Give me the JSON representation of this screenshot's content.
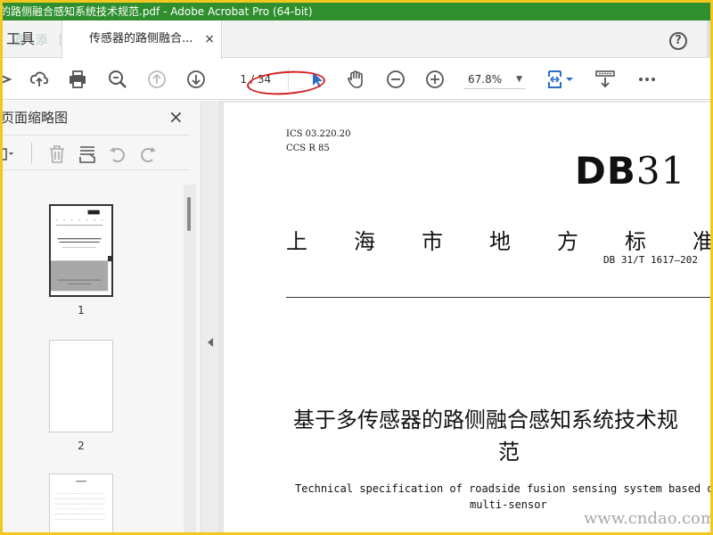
{
  "window": {
    "title": "的路侧融合感知系统技术规范.pdf - Adobe Acrobat Pro (64-bit)"
  },
  "tabs": {
    "tools_label": "工具",
    "doc_label": "传感器的路侧融合...",
    "close_glyph": "×"
  },
  "help": {
    "glyph": "?"
  },
  "watermark": {
    "top": "道 添 网",
    "bottom": "www.cndao.com"
  },
  "toolbar": {
    "page_current": "1",
    "page_total": "/ 34",
    "zoom": "67.8%",
    "zoom_arrow": "▼",
    "icons": [
      "send-icon",
      "upload-icon",
      "print-icon",
      "zoom-search-icon",
      "page-up-icon",
      "page-down-icon",
      "pointer-icon",
      "hand-icon",
      "zoom-out-icon",
      "zoom-in-icon",
      "fit-page-icon",
      "scroll-mode-icon",
      "more-icon"
    ]
  },
  "sidebar": {
    "title": "页面缩略图",
    "close_glyph": "×",
    "thumbnails": [
      {
        "label": "1"
      },
      {
        "label": "2"
      }
    ]
  },
  "document": {
    "ics": "ICS  03.220.20",
    "ccs": "CCS R 85",
    "logo_text": "DB",
    "logo_num": "31",
    "standard_title": "上海市地方标准",
    "standard_number": "DB 31/T 1617—202",
    "title_line1": "基于多传感器的路侧融合感知系统技术规",
    "title_line2": "范",
    "en_line1": "Technical specification of roadside fusion sensing system based o",
    "en_line2": "multi-sensor"
  },
  "colors": {
    "titlebar": "#2f8f2f",
    "annotation": "#d42020",
    "border": "#f2c81e",
    "accent_icon": "#2b6cc4"
  }
}
